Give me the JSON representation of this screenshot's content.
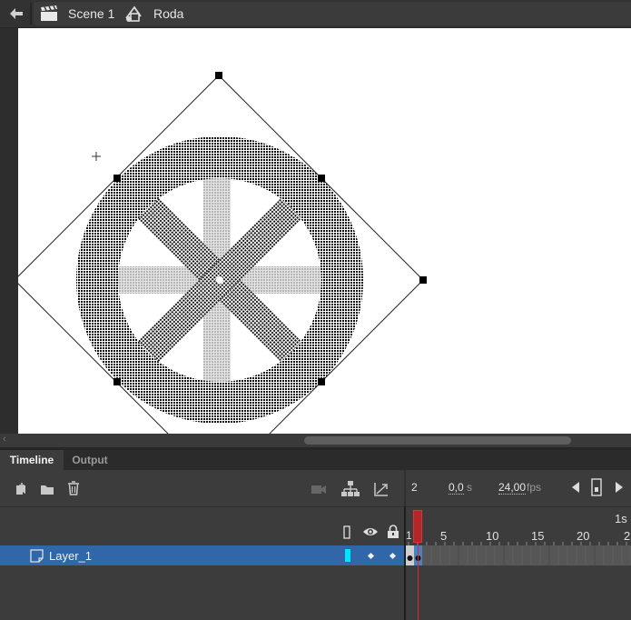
{
  "breadcrumb": {
    "scene": "Scene 1",
    "symbol": "Roda"
  },
  "panel_tabs": {
    "timeline": "Timeline",
    "output": "Output"
  },
  "frame_info": {
    "current_frame": "2",
    "time": "0,0",
    "time_unit": "s",
    "fps": "24,00",
    "fps_unit": "fps"
  },
  "ruler": {
    "labels": [
      "1",
      "5",
      "10",
      "15",
      "20",
      "2"
    ],
    "seconds_label": "1s"
  },
  "layers": [
    {
      "name": "Layer_1",
      "color": "#00e5ff"
    }
  ],
  "colors": {
    "selection": "#2f67a8",
    "playhead": "#c62828",
    "layer_color": "#00e5ff"
  },
  "icons": {
    "back": "arrow-left-icon",
    "scene": "clapperboard-icon",
    "symbol": "graphic-symbol-icon",
    "new_layer": "new-layer-icon",
    "new_folder": "folder-icon",
    "delete": "trash-icon",
    "camera": "camera-icon",
    "parenting": "hierarchy-icon",
    "easing": "graph-icon",
    "outline": "outline-icon",
    "visibility": "eye-icon",
    "lock": "lock-icon"
  }
}
